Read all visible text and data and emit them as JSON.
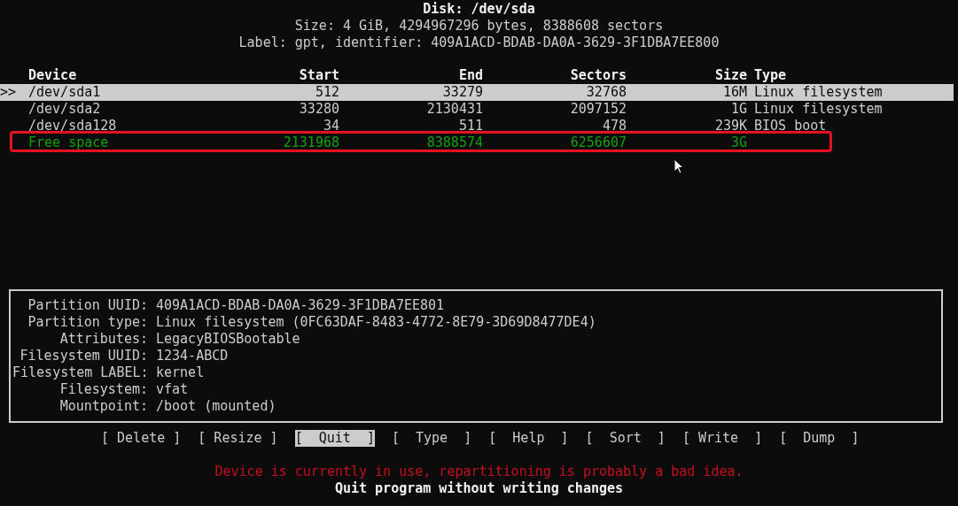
{
  "disk": {
    "title": "Disk: /dev/sda",
    "size_line": "Size: 4 GiB, 4294967296 bytes, 8388608 sectors",
    "label_line": "Label: gpt, identifier: 409A1ACD-BDAB-DA0A-3629-3F1DBA7EE800"
  },
  "table": {
    "cursor": ">>",
    "columns": [
      "Device",
      "Start",
      "End",
      "Sectors",
      "Size",
      "Type"
    ],
    "rows": [
      {
        "kind": "partition",
        "selected": true,
        "highlighted": false,
        "cells": [
          "/dev/sda1",
          "512",
          "33279",
          "32768",
          "16M",
          "Linux filesystem"
        ]
      },
      {
        "kind": "partition",
        "selected": false,
        "highlighted": false,
        "cells": [
          "/dev/sda2",
          "33280",
          "2130431",
          "2097152",
          "1G",
          "Linux filesystem"
        ]
      },
      {
        "kind": "partition",
        "selected": false,
        "highlighted": false,
        "cells": [
          "/dev/sda128",
          "34",
          "511",
          "478",
          "239K",
          "BIOS boot"
        ]
      },
      {
        "kind": "free",
        "selected": false,
        "highlighted": true,
        "cells": [
          "Free space",
          "2131968",
          "8388574",
          "6256607",
          "3G",
          ""
        ]
      }
    ]
  },
  "details": [
    {
      "label": "Partition UUID:",
      "value": "409A1ACD-BDAB-DA0A-3629-3F1DBA7EE801"
    },
    {
      "label": "Partition type:",
      "value": "Linux filesystem (0FC63DAF-8483-4772-8E79-3D69D8477DE4)"
    },
    {
      "label": "Attributes:",
      "value": "LegacyBIOSBootable"
    },
    {
      "label": "Filesystem UUID:",
      "value": "1234-ABCD"
    },
    {
      "label": "Filesystem LABEL:",
      "value": "kernel"
    },
    {
      "label": "Filesystem:",
      "value": "vfat"
    },
    {
      "label": "Mountpoint:",
      "value": "/boot (mounted)"
    }
  ],
  "menu": [
    {
      "label": "[ Delete ]",
      "selected": false
    },
    {
      "label": "[ Resize ]",
      "selected": false
    },
    {
      "label": "[  Quit  ]",
      "selected": true
    },
    {
      "label": "[  Type  ]",
      "selected": false
    },
    {
      "label": "[  Help  ]",
      "selected": false
    },
    {
      "label": "[  Sort  ]",
      "selected": false
    },
    {
      "label": "[ Write  ]",
      "selected": false
    },
    {
      "label": "[  Dump  ]",
      "selected": false
    }
  ],
  "warning": "Device is currently in use, repartitioning is probably a bad idea.",
  "status": "Quit program without writing changes"
}
